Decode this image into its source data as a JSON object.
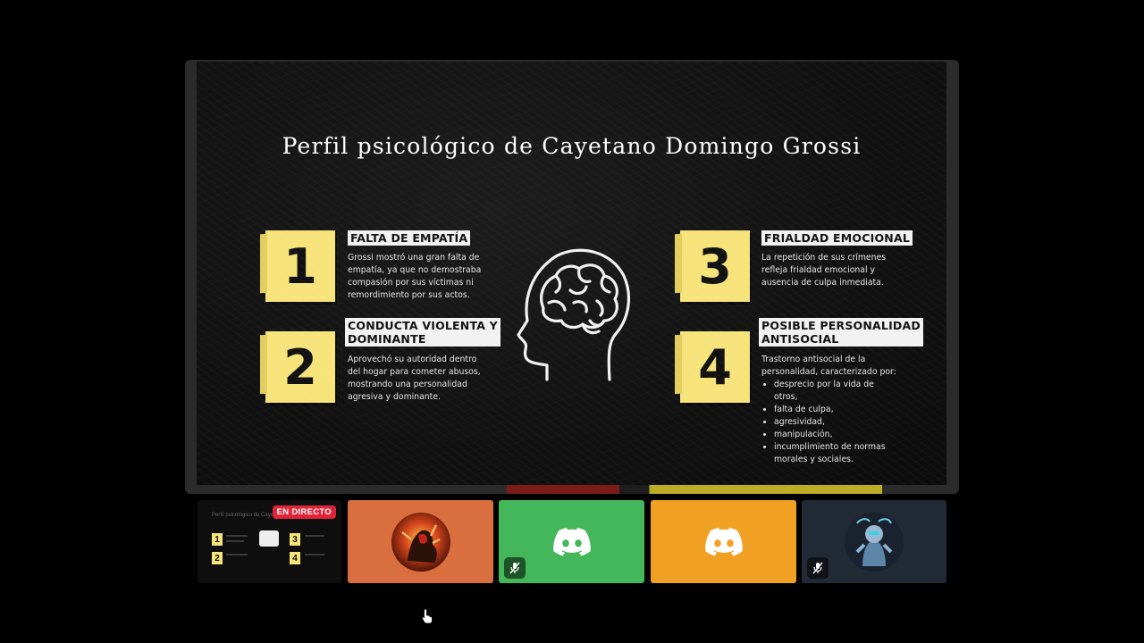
{
  "slide": {
    "title": "Perfil psicológico de Cayetano Domingo Grossi",
    "items": [
      {
        "number": "1",
        "heading": "FALTA DE EMPATÍA",
        "lines": [
          "Grossi mostró una gran falta de",
          "empatía, ya que no demostraba",
          "compasión por sus víctimas ni",
          "remordimiento por sus actos."
        ]
      },
      {
        "number": "2",
        "heading_lines": [
          "CONDUCTA VIOLENTA Y",
          "DOMINANTE"
        ],
        "lines": [
          "Aprovechó su autoridad dentro",
          "del hogar para cometer abusos,",
          "mostrando una personalidad",
          "agresiva y dominante."
        ]
      },
      {
        "number": "3",
        "heading": "FRIALDAD EMOCIONAL",
        "lines": [
          "La repetición de sus crímenes",
          "refleja frialdad emocional y",
          "ausencia de culpa inmediata."
        ]
      },
      {
        "number": "4",
        "heading_lines": [
          "POSIBLE PERSONALIDAD",
          "ANTISOCIAL"
        ],
        "lines": [
          "Trastorno antisocial de la",
          "personalidad, caracterizado por:"
        ],
        "bullets": [
          [
            "desprecio por la vida de",
            "otros,"
          ],
          [
            "falta de culpa,"
          ],
          [
            "agresividad,"
          ],
          [
            "manipulación,"
          ],
          [
            "incumplimiento de normas",
            "morales y sociales."
          ]
        ]
      }
    ]
  },
  "participants": {
    "preview": {
      "badge": "EN DIRECTO",
      "mini_title": "Perfil psicológico de Cayetano Domingo Grossi",
      "mini_numbers": [
        "1",
        "2",
        "3",
        "4"
      ]
    },
    "tiles": [
      {
        "kind": "avatar",
        "avatar_icon": "warrior-avatar",
        "color": "#d96f3f",
        "muted": false
      },
      {
        "kind": "discord",
        "icon": "discord-icon",
        "color": "#43b75a",
        "muted": true
      },
      {
        "kind": "discord",
        "icon": "discord-icon",
        "color": "#f0a023",
        "muted": false
      },
      {
        "kind": "avatar",
        "avatar_icon": "robot-avatar",
        "color": "#222a36",
        "muted": true
      }
    ]
  }
}
